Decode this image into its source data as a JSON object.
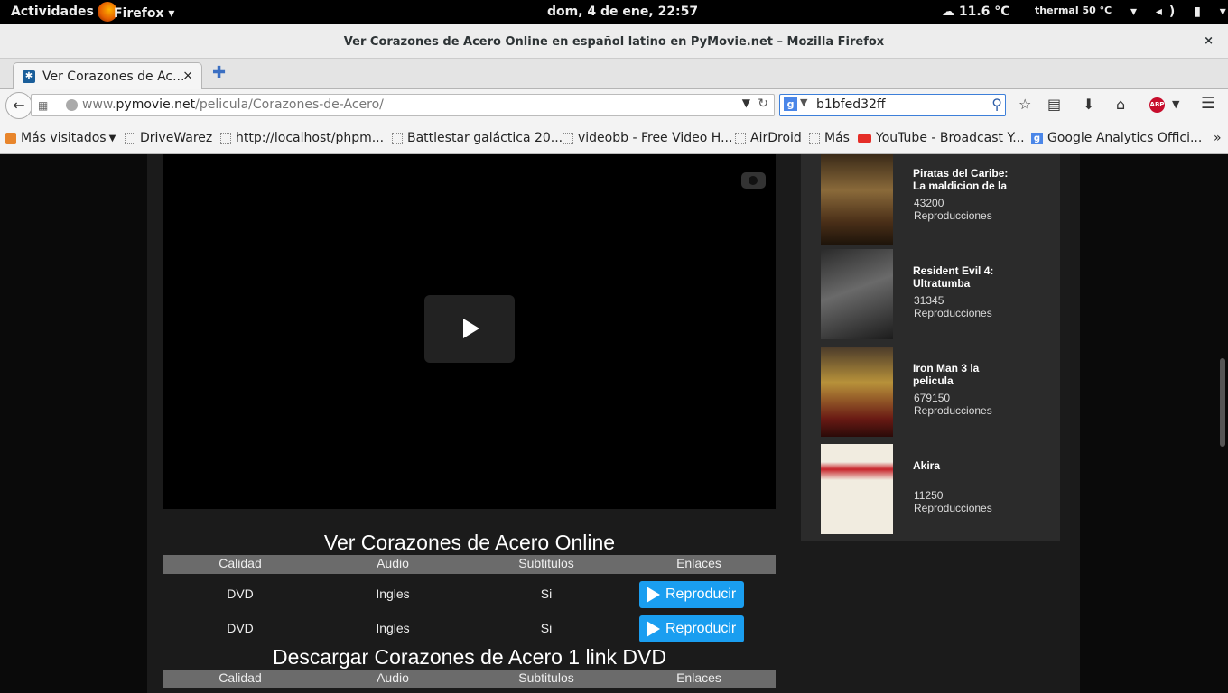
{
  "topbar": {
    "activities": "Actividades",
    "app": "Firefox ▾",
    "clock": "dom,  4 de ene, 22:57",
    "weather": "☁ 11.6 °C",
    "thermal": "thermal 50 °C",
    "tray": "▾ ◂) ▮ ▾"
  },
  "window": {
    "title": "Ver Corazones de Acero Online en español latino en PyMovie.net – Mozilla Firefox",
    "close": "×"
  },
  "tabs": [
    {
      "label": "Ver Corazones de Ac...",
      "close": "×"
    }
  ],
  "newtab": "✚",
  "navbar": {
    "back": "←",
    "url_domain": "www.pymovie.net",
    "url_path": "/pelicula/Corazones-de-Acero/",
    "url_prefix": "www.",
    "search_engine": "g",
    "search_value": "b1bfed32ff",
    "icons": [
      "star-icon",
      "clipboard-icon",
      "download-icon",
      "home-icon",
      "adblock-icon",
      "menu-icon"
    ],
    "abp_label": "ABP"
  },
  "bookmarks": [
    {
      "label": "Más visitados"
    },
    {
      "label": "DriveWarez"
    },
    {
      "label": "http://localhost/phpm..."
    },
    {
      "label": "Battlestar galáctica 20..."
    },
    {
      "label": "videobb - Free Video H..."
    },
    {
      "label": "AirDroid"
    },
    {
      "label": "Más"
    },
    {
      "label": "YouTube - Broadcast Y..."
    },
    {
      "label": "Google Analytics Offici..."
    }
  ],
  "main": {
    "watch_title": "Ver Corazones de Acero Online",
    "download_title": "Descargar Corazones de Acero 1 link DVD",
    "table_headers": [
      "Calidad",
      "Audio",
      "Subtitulos",
      "Enlaces"
    ],
    "rows": [
      {
        "calidad": "DVD",
        "audio": "Ingles",
        "subtitulos": "Si",
        "enlace": "Reproducir"
      },
      {
        "calidad": "DVD",
        "audio": "Ingles",
        "subtitulos": "Si",
        "enlace": "Reproducir"
      }
    ]
  },
  "sidebar": {
    "movies": [
      {
        "title": "Piratas del Caribe: La maldicion de la",
        "count": "43200",
        "label": "Reproducciones"
      },
      {
        "title": "Resident Evil 4: Ultratumba",
        "count": "31345",
        "label": "Reproducciones"
      },
      {
        "title": "Iron Man 3 la pelicula",
        "count": "679150",
        "label": "Reproducciones"
      },
      {
        "title": "Akira",
        "count": "11250",
        "label": "Reproducciones"
      }
    ]
  },
  "colors": {
    "accent": "#1a9ef0",
    "table_header_bg": "#6b6b6b",
    "page_bg": "#1b1b1b"
  }
}
